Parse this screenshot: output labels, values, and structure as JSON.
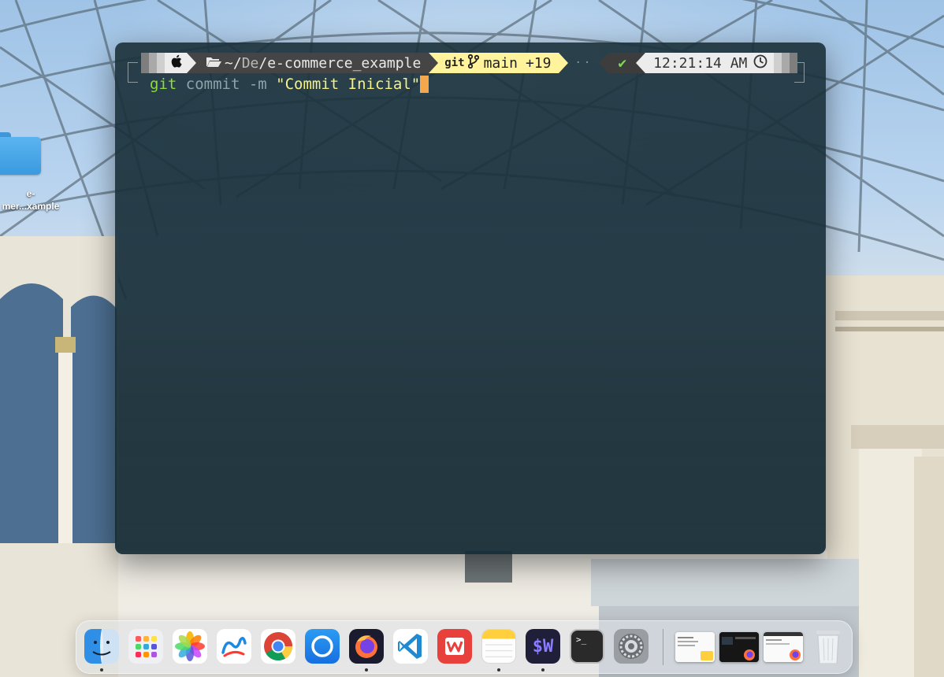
{
  "desktop": {
    "folder_label": "e-\nmer...xample"
  },
  "terminal": {
    "prompt": {
      "apple_icon": "apple-icon",
      "folder_icon": "folder-icon",
      "path_prefix": "~/",
      "path_dim": "De",
      "path_sep": "/",
      "path_current": "e-commerce_example",
      "git_label": "git",
      "branch_icon": "git-branch-icon",
      "branch": "main",
      "ahead": "+19",
      "status_symbol": "✔",
      "time": "12:21:14 AM",
      "clock_icon": "clock-icon"
    },
    "command": {
      "program": "git",
      "subcommand": " commit -m ",
      "message": "\"Commit Inicial\""
    }
  },
  "dock": {
    "apps": [
      {
        "name": "Finder",
        "icon": "finder-icon",
        "running": true
      },
      {
        "name": "Launchpad",
        "icon": "launchpad-icon",
        "running": false
      },
      {
        "name": "Photos",
        "icon": "photos-icon",
        "running": false
      },
      {
        "name": "Freeform",
        "icon": "freeform-icon",
        "running": false
      },
      {
        "name": "Google Chrome",
        "icon": "chrome-icon",
        "running": false
      },
      {
        "name": "Messenger",
        "icon": "chat-icon",
        "running": false
      },
      {
        "name": "Firefox",
        "icon": "firefox-icon",
        "running": true
      },
      {
        "name": "Visual Studio Code",
        "icon": "vscode-icon",
        "running": false
      },
      {
        "name": "WPS Office",
        "icon": "wps-icon",
        "running": false
      },
      {
        "name": "Notes",
        "icon": "notes-icon",
        "running": true
      },
      {
        "name": "Warp",
        "icon": "warp-icon",
        "running": true
      },
      {
        "name": "Terminal",
        "icon": "terminal-icon",
        "running": false
      },
      {
        "name": "System Settings",
        "icon": "settings-icon",
        "running": false
      }
    ],
    "warp_text": "$W",
    "terminal_text": ">_",
    "minimized": [
      "notes-window-thumbnail",
      "firefox-window-thumbnail-1",
      "firefox-window-thumbnail-2"
    ],
    "trash_icon": "trash-icon"
  }
}
